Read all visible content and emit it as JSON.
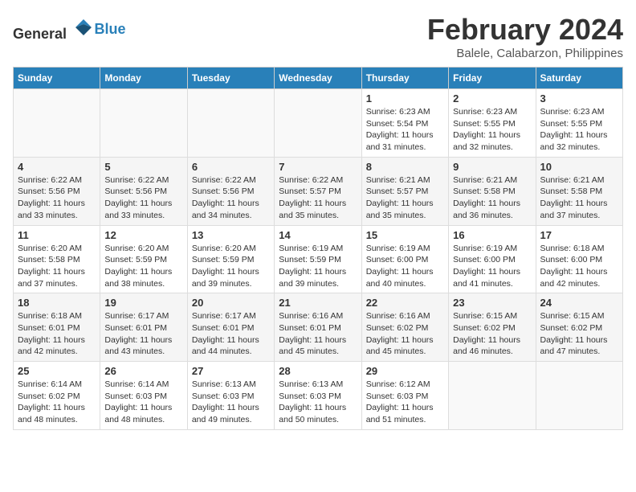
{
  "header": {
    "logo_general": "General",
    "logo_blue": "Blue",
    "title": "February 2024",
    "subtitle": "Balele, Calabarzon, Philippines"
  },
  "columns": [
    "Sunday",
    "Monday",
    "Tuesday",
    "Wednesday",
    "Thursday",
    "Friday",
    "Saturday"
  ],
  "weeks": [
    [
      {
        "day": "",
        "info": ""
      },
      {
        "day": "",
        "info": ""
      },
      {
        "day": "",
        "info": ""
      },
      {
        "day": "",
        "info": ""
      },
      {
        "day": "1",
        "info": "Sunrise: 6:23 AM\nSunset: 5:54 PM\nDaylight: 11 hours and 31 minutes."
      },
      {
        "day": "2",
        "info": "Sunrise: 6:23 AM\nSunset: 5:55 PM\nDaylight: 11 hours and 32 minutes."
      },
      {
        "day": "3",
        "info": "Sunrise: 6:23 AM\nSunset: 5:55 PM\nDaylight: 11 hours and 32 minutes."
      }
    ],
    [
      {
        "day": "4",
        "info": "Sunrise: 6:22 AM\nSunset: 5:56 PM\nDaylight: 11 hours and 33 minutes."
      },
      {
        "day": "5",
        "info": "Sunrise: 6:22 AM\nSunset: 5:56 PM\nDaylight: 11 hours and 33 minutes."
      },
      {
        "day": "6",
        "info": "Sunrise: 6:22 AM\nSunset: 5:56 PM\nDaylight: 11 hours and 34 minutes."
      },
      {
        "day": "7",
        "info": "Sunrise: 6:22 AM\nSunset: 5:57 PM\nDaylight: 11 hours and 35 minutes."
      },
      {
        "day": "8",
        "info": "Sunrise: 6:21 AM\nSunset: 5:57 PM\nDaylight: 11 hours and 35 minutes."
      },
      {
        "day": "9",
        "info": "Sunrise: 6:21 AM\nSunset: 5:58 PM\nDaylight: 11 hours and 36 minutes."
      },
      {
        "day": "10",
        "info": "Sunrise: 6:21 AM\nSunset: 5:58 PM\nDaylight: 11 hours and 37 minutes."
      }
    ],
    [
      {
        "day": "11",
        "info": "Sunrise: 6:20 AM\nSunset: 5:58 PM\nDaylight: 11 hours and 37 minutes."
      },
      {
        "day": "12",
        "info": "Sunrise: 6:20 AM\nSunset: 5:59 PM\nDaylight: 11 hours and 38 minutes."
      },
      {
        "day": "13",
        "info": "Sunrise: 6:20 AM\nSunset: 5:59 PM\nDaylight: 11 hours and 39 minutes."
      },
      {
        "day": "14",
        "info": "Sunrise: 6:19 AM\nSunset: 5:59 PM\nDaylight: 11 hours and 39 minutes."
      },
      {
        "day": "15",
        "info": "Sunrise: 6:19 AM\nSunset: 6:00 PM\nDaylight: 11 hours and 40 minutes."
      },
      {
        "day": "16",
        "info": "Sunrise: 6:19 AM\nSunset: 6:00 PM\nDaylight: 11 hours and 41 minutes."
      },
      {
        "day": "17",
        "info": "Sunrise: 6:18 AM\nSunset: 6:00 PM\nDaylight: 11 hours and 42 minutes."
      }
    ],
    [
      {
        "day": "18",
        "info": "Sunrise: 6:18 AM\nSunset: 6:01 PM\nDaylight: 11 hours and 42 minutes."
      },
      {
        "day": "19",
        "info": "Sunrise: 6:17 AM\nSunset: 6:01 PM\nDaylight: 11 hours and 43 minutes."
      },
      {
        "day": "20",
        "info": "Sunrise: 6:17 AM\nSunset: 6:01 PM\nDaylight: 11 hours and 44 minutes."
      },
      {
        "day": "21",
        "info": "Sunrise: 6:16 AM\nSunset: 6:01 PM\nDaylight: 11 hours and 45 minutes."
      },
      {
        "day": "22",
        "info": "Sunrise: 6:16 AM\nSunset: 6:02 PM\nDaylight: 11 hours and 45 minutes."
      },
      {
        "day": "23",
        "info": "Sunrise: 6:15 AM\nSunset: 6:02 PM\nDaylight: 11 hours and 46 minutes."
      },
      {
        "day": "24",
        "info": "Sunrise: 6:15 AM\nSunset: 6:02 PM\nDaylight: 11 hours and 47 minutes."
      }
    ],
    [
      {
        "day": "25",
        "info": "Sunrise: 6:14 AM\nSunset: 6:02 PM\nDaylight: 11 hours and 48 minutes."
      },
      {
        "day": "26",
        "info": "Sunrise: 6:14 AM\nSunset: 6:03 PM\nDaylight: 11 hours and 48 minutes."
      },
      {
        "day": "27",
        "info": "Sunrise: 6:13 AM\nSunset: 6:03 PM\nDaylight: 11 hours and 49 minutes."
      },
      {
        "day": "28",
        "info": "Sunrise: 6:13 AM\nSunset: 6:03 PM\nDaylight: 11 hours and 50 minutes."
      },
      {
        "day": "29",
        "info": "Sunrise: 6:12 AM\nSunset: 6:03 PM\nDaylight: 11 hours and 51 minutes."
      },
      {
        "day": "",
        "info": ""
      },
      {
        "day": "",
        "info": ""
      }
    ]
  ]
}
